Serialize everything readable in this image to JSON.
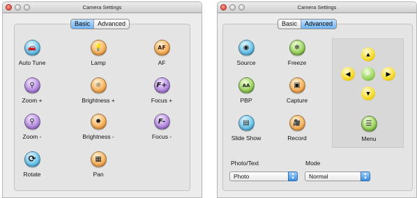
{
  "window_basic": {
    "title": "Camera Settings",
    "tabs": [
      "Basic",
      "Advanced"
    ],
    "selected_tab": "Basic",
    "tools": [
      {
        "label": "Auto Tune",
        "icon": "car-icon",
        "glyph": "🚗",
        "color": "blue"
      },
      {
        "label": "Lamp",
        "icon": "bulb-icon",
        "glyph": "💡",
        "color": "orange"
      },
      {
        "label": "AF",
        "icon": "af-icon",
        "glyph": "AF",
        "color": "orange"
      },
      {
        "label": "Zoom +",
        "icon": "zoom-in-icon",
        "glyph": "⚲",
        "color": "purple"
      },
      {
        "label": "Brightness +",
        "icon": "brightness-up-icon",
        "glyph": "☼",
        "color": "orange"
      },
      {
        "label": "Focus +",
        "icon": "focus-plus-icon",
        "glyph": "F+",
        "color": "purple"
      },
      {
        "label": "Zoom -",
        "icon": "zoom-out-icon",
        "glyph": "⚲",
        "color": "purple"
      },
      {
        "label": "Brightness -",
        "icon": "brightness-down-icon",
        "glyph": "✹",
        "color": "orange"
      },
      {
        "label": "Focus -",
        "icon": "focus-minus-icon",
        "glyph": "F-",
        "color": "purple"
      },
      {
        "label": "Rotate",
        "icon": "rotate-icon",
        "glyph": "⟳",
        "color": "blue"
      },
      {
        "label": "Pan",
        "icon": "pan-icon",
        "glyph": "▦",
        "color": "orange"
      }
    ]
  },
  "window_advanced": {
    "title": "Camera Settings",
    "tabs": [
      "Basic",
      "Advanced"
    ],
    "selected_tab": "Advanced",
    "tools": [
      {
        "label": "Source",
        "icon": "source-icon",
        "glyph": "◉",
        "color": "blue"
      },
      {
        "label": "Freeze",
        "icon": "freeze-icon",
        "glyph": "❄",
        "color": "green"
      },
      {
        "label": "PBP",
        "icon": "pbp-icon",
        "glyph": "AA",
        "color": "green"
      },
      {
        "label": "Capture",
        "icon": "capture-icon",
        "glyph": "▣",
        "color": "orange"
      },
      {
        "label": "Slide Show",
        "icon": "slideshow-icon",
        "glyph": "▤",
        "color": "blue"
      },
      {
        "label": "Record",
        "icon": "record-icon",
        "glyph": "🎥",
        "color": "orange"
      },
      {
        "label": "Menu",
        "icon": "menu-icon",
        "glyph": "☰",
        "color": "green"
      }
    ],
    "dpad": {
      "up": "▲",
      "left": "◀",
      "enter": "↵",
      "right": "▶",
      "down": "▼"
    },
    "photo_text_label": "Photo/Text",
    "mode_label": "Mode",
    "photo_text_value": "Photo",
    "mode_value": "Normal"
  }
}
